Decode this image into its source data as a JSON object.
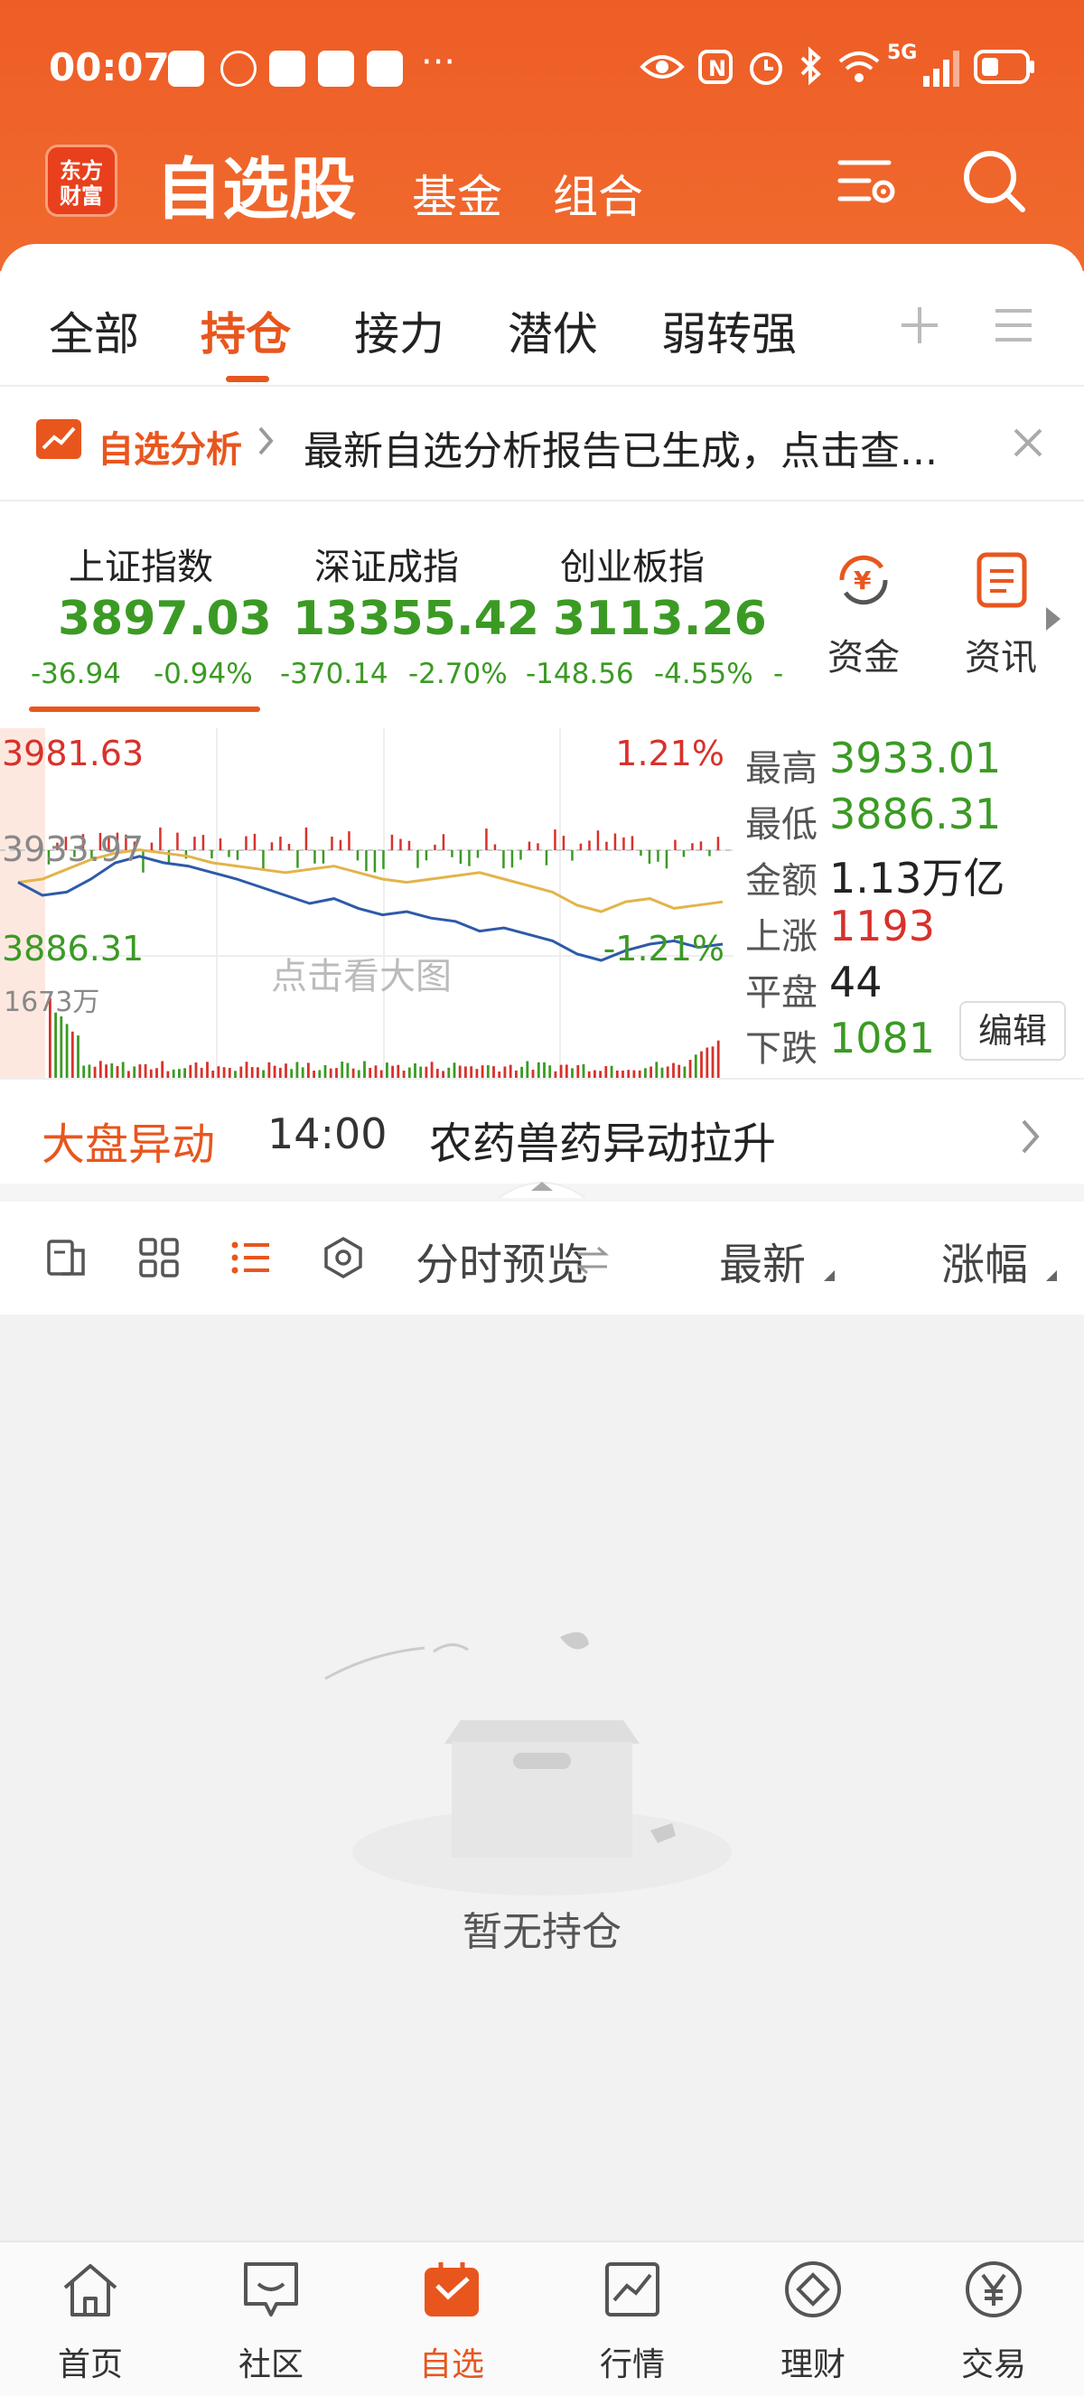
{
  "status_bar": {
    "time": "00:07",
    "network": "5G"
  },
  "header": {
    "logo_line1": "东方",
    "logo_line2": "财富",
    "title": "自选股",
    "links": [
      "基金",
      "组合"
    ],
    "settings_icon": "list-settings-icon",
    "search_icon": "search-icon",
    "brand_color": "#ee5d26"
  },
  "tabs": [
    "全部",
    "持仓",
    "接力",
    "潜伏",
    "弱转强"
  ],
  "active_tab": "持仓",
  "banner": {
    "tag": "自选分析",
    "text": "最新自选分析报告已生成，点击查..."
  },
  "indices": [
    {
      "name": "上证指数",
      "value": "3897.03",
      "change": "-36.94",
      "pct": "-0.94%"
    },
    {
      "name": "深证成指",
      "value": "13355.42",
      "change": "-370.14",
      "pct": "-2.70%"
    },
    {
      "name": "创业板指",
      "value": "3113.26",
      "change": "-148.56",
      "pct": "-4.55%"
    }
  ],
  "index_more": "-",
  "side_buttons": {
    "funds": "资金",
    "news": "资讯"
  },
  "chart": {
    "high_label": "3981.63",
    "high_pct": "1.21%",
    "mid_label": "3933.97",
    "low_label": "3886.31",
    "low_pct": "-1.21%",
    "volume_label": "1673万",
    "overlay_text": "点击看大图"
  },
  "stats": {
    "high_label": "最高",
    "high": "3933.01",
    "low_label": "最低",
    "low": "3886.31",
    "amount_label": "金额",
    "amount": "1.13万亿",
    "up_label": "上涨",
    "up": "1193",
    "flat_label": "平盘",
    "flat": "44",
    "down_label": "下跌",
    "down": "1081",
    "edit": "编辑"
  },
  "alert": {
    "tag": "大盘异动",
    "time": "14:00",
    "text": "农药兽药异动拉升"
  },
  "toolbar": {
    "preview": "分时预览",
    "latest": "最新",
    "change": "涨幅"
  },
  "empty": {
    "text": "暂无持仓"
  },
  "bottom_nav": [
    {
      "label": "首页",
      "icon": "home-icon"
    },
    {
      "label": "社区",
      "icon": "chat-icon"
    },
    {
      "label": "自选",
      "icon": "watchlist-icon"
    },
    {
      "label": "行情",
      "icon": "chart-icon"
    },
    {
      "label": "理财",
      "icon": "diamond-icon"
    },
    {
      "label": "交易",
      "icon": "yen-icon"
    }
  ],
  "active_nav": "自选",
  "colors": {
    "up": "#d8312b",
    "down": "#3b9a24",
    "accent": "#e8561e"
  }
}
